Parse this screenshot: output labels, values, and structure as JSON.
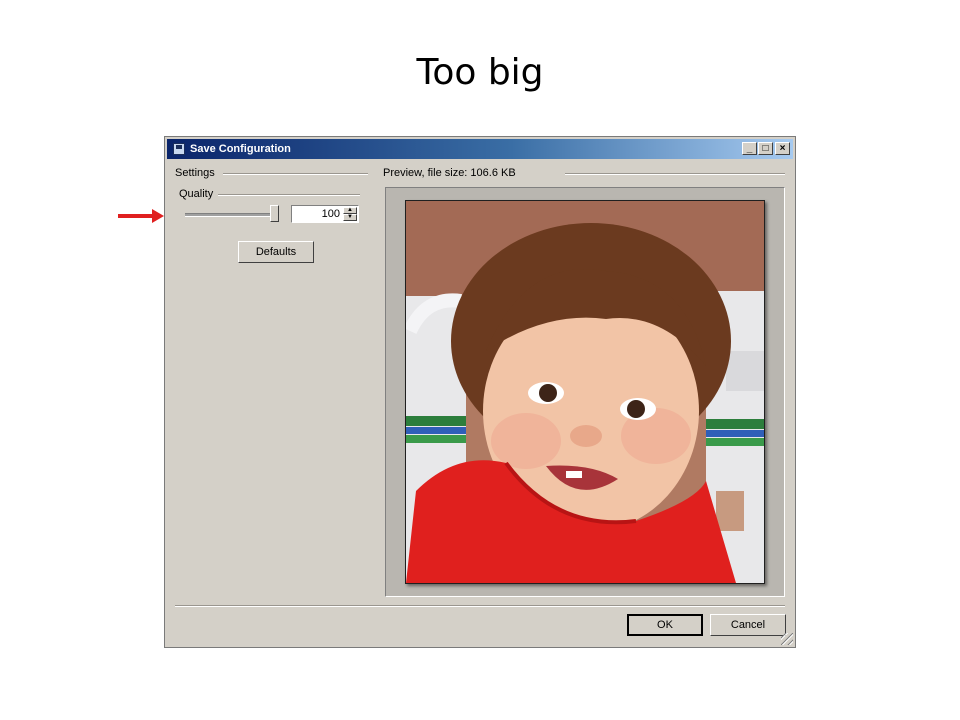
{
  "slide": {
    "title": "Too big"
  },
  "dialog": {
    "title": "Save Configuration",
    "window_buttons": {
      "minimize": "_",
      "maximize": "□",
      "close": "×"
    },
    "settings_label": "Settings",
    "quality_label": "Quality",
    "quality_value": "100",
    "quality_fraction": 1.0,
    "defaults_button": "Defaults",
    "preview_label": "Preview, file size: 106.6 KB",
    "ok_button": "OK",
    "cancel_button": "Cancel",
    "preview_image": "photo of a smiling toddler in a red shirt",
    "annotation_color": "#e02020"
  }
}
